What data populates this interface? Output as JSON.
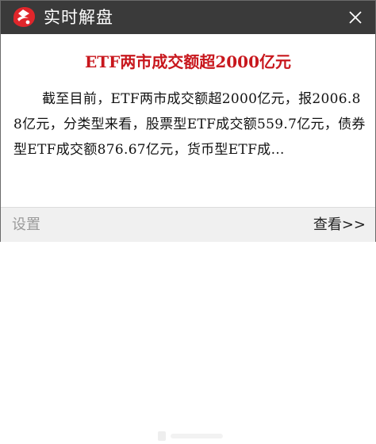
{
  "window": {
    "title": "实时解盘",
    "logo_icon": "brand-logo-icon",
    "close_icon": "close-icon"
  },
  "content": {
    "headline": "ETF两市成交额超2000亿元",
    "body": "截至目前，ETF两市成交额超2000亿元，报2006.88亿元，分类型来看，股票型ETF成交额559.7亿元，债券型ETF成交额876.67亿元，货币型ETF成…"
  },
  "footer": {
    "settings_label": "设置",
    "view_label": "查看>>"
  },
  "colors": {
    "titlebar": "#3a3a3a",
    "headline": "#c8171d",
    "logo": "#e0262b",
    "footer_bg": "#f0f0f0"
  }
}
